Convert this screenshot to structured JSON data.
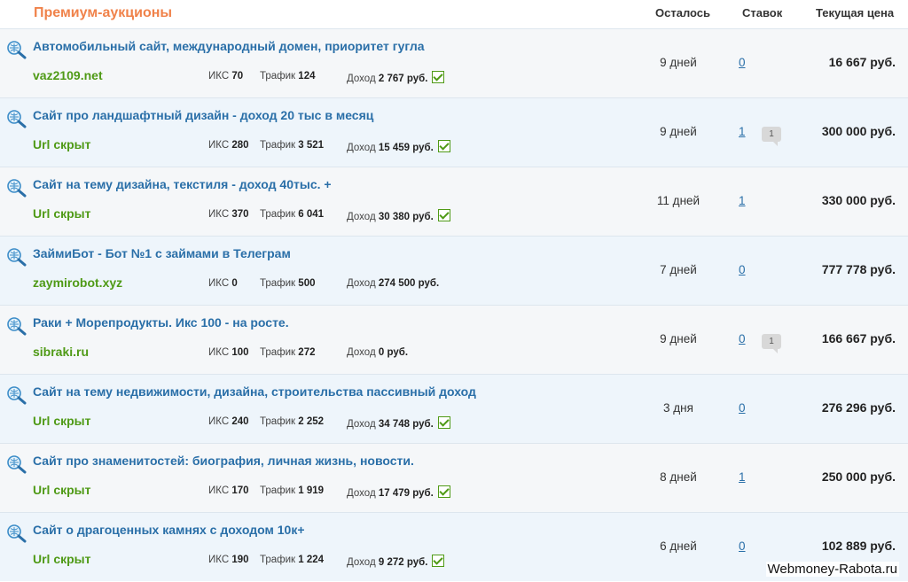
{
  "header": {
    "title": "Премиум-аукционы",
    "col_left": "Осталось",
    "col_bids": "Ставок",
    "col_price": "Текущая цена"
  },
  "labels": {
    "iks": "ИКС",
    "traffic": "Трафик",
    "income": "Доход"
  },
  "rows": [
    {
      "name": "Автомобильный сайт, международный домен, приоритет гугла",
      "url": "vaz2109.net",
      "iks": "70",
      "traffic": "124",
      "income": "2 767 руб.",
      "verified": true,
      "left": "9 дней",
      "bids": "0",
      "comments": "",
      "price": "16 667 руб."
    },
    {
      "name": "Сайт про ландшафтный дизайн - доход 20 тыс в месяц",
      "url": "Url скрыт",
      "iks": "280",
      "traffic": "3 521",
      "income": "15 459 руб.",
      "verified": true,
      "left": "9 дней",
      "bids": "1",
      "comments": "1",
      "price": "300 000 руб."
    },
    {
      "name": "Сайт на тему дизайна, текстиля - доход 40тыс. +",
      "url": "Url скрыт",
      "iks": "370",
      "traffic": "6 041",
      "income": "30 380 руб.",
      "verified": true,
      "left": "11 дней",
      "bids": "1",
      "comments": "",
      "price": "330 000 руб."
    },
    {
      "name": "ЗаймиБот - Бот №1 с займами в Телеграм",
      "url": "zaymirobot.xyz",
      "iks": "0",
      "traffic": "500",
      "income": "274 500 руб.",
      "verified": false,
      "left": "7 дней",
      "bids": "0",
      "comments": "",
      "price": "777 778 руб."
    },
    {
      "name": "Раки + Морепродукты. Икс 100 - на росте.",
      "url": "sibraki.ru",
      "iks": "100",
      "traffic": "272",
      "income": "0 руб.",
      "verified": false,
      "left": "9 дней",
      "bids": "0",
      "comments": "1",
      "price": "166 667 руб."
    },
    {
      "name": "Сайт на тему недвижимости, дизайна, строительства пассивный доход",
      "url": "Url скрыт",
      "iks": "240",
      "traffic": "2 252",
      "income": "34 748 руб.",
      "verified": true,
      "left": "3 дня",
      "bids": "0",
      "comments": "",
      "price": "276 296 руб."
    },
    {
      "name": "Сайт про знаменитостей: биография, личная жизнь, новости.",
      "url": "Url скрыт",
      "iks": "170",
      "traffic": "1 919",
      "income": "17 479 руб.",
      "verified": true,
      "left": "8 дней",
      "bids": "1",
      "comments": "",
      "price": "250 000 руб."
    },
    {
      "name": "Сайт о драгоценных камнях с доходом 10к+",
      "url": "Url скрыт",
      "iks": "190",
      "traffic": "1 224",
      "income": "9 272 руб.",
      "verified": true,
      "left": "6 дней",
      "bids": "0",
      "comments": "",
      "price": "102 889 руб."
    }
  ],
  "watermark": "Webmoney-Rabota.ru",
  "colors": {
    "title": "#f0824a",
    "link": "#2a6fa8",
    "url": "#4f9a16"
  }
}
